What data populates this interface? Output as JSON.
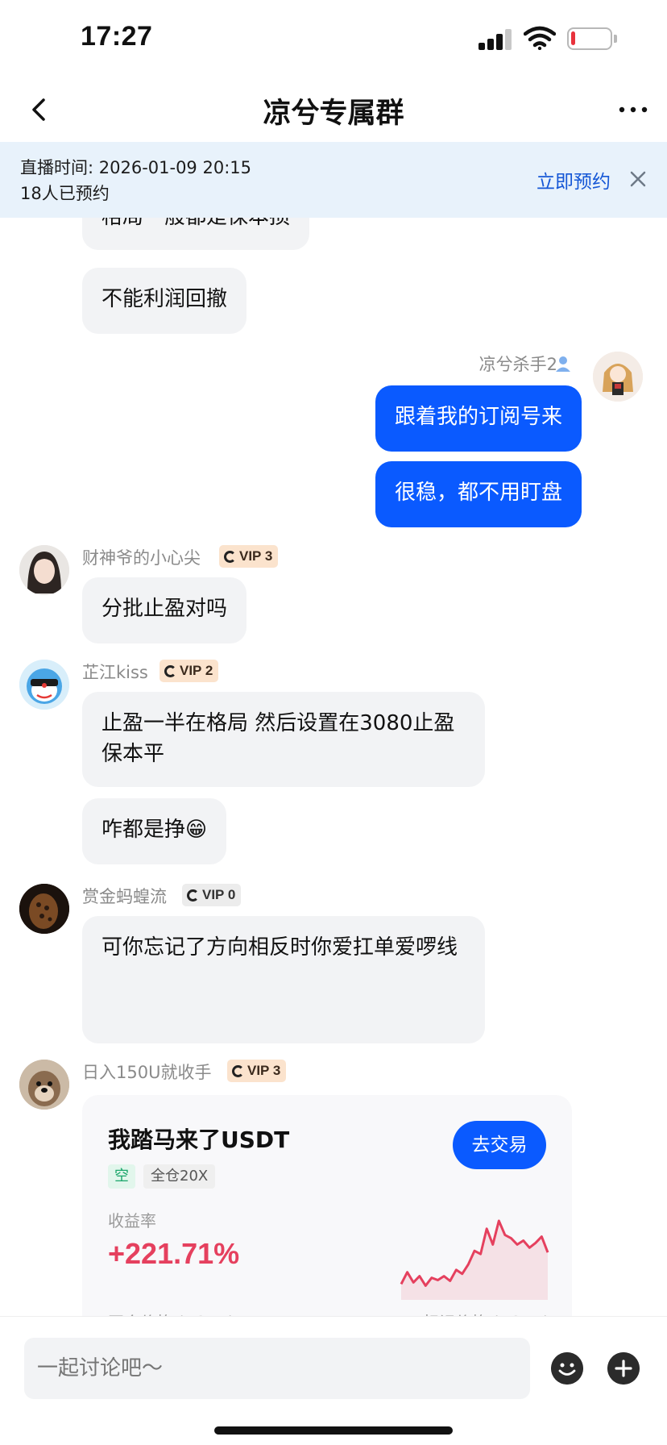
{
  "status_bar": {
    "time": "17:27",
    "battery_level": 0.1
  },
  "nav": {
    "title": "凉兮专属群"
  },
  "banner": {
    "line1": "直播时间: 2026-01-09 20:15",
    "line2": "18人已预约",
    "action_label": "立即预约"
  },
  "messages": {
    "m1": "格局一般都是保本损",
    "m2": "不能利润回撤",
    "self_name": "凉兮杀手2",
    "m3": "跟着我的订阅号来",
    "m4": "很稳，都不用盯盘",
    "u1_name": "财神爷的小心尖",
    "u1_vip": "VIP 3",
    "m5": "分批止盈对吗",
    "u2_name": "芷江kiss",
    "u2_vip": "VIP 2",
    "m6": "止盈一半在格局  然后设置在3080止盈保本平",
    "m7": "咋都是挣",
    "m7_emoji": "😁",
    "u3_name": "赏金蚂蝗流",
    "u3_vip": "VIP 0",
    "m8": "可你忘记了方向相反时你爱扛单爱啰线",
    "u4_name": "日入150U就收手",
    "u4_vip": "VIP 3"
  },
  "trade_card": {
    "title": "我踏马来了USDT",
    "button": "去交易",
    "side_tag": "空",
    "leverage_tag": "全仓20X",
    "pnl_label": "收益率",
    "pnl_value": "+221.71%",
    "col_left": "开仓价格 (USDT)",
    "col_right": "标记价格 (USDT)",
    "sparkline": [
      [
        0,
        0.2
      ],
      [
        1,
        0.35
      ],
      [
        2,
        0.22
      ],
      [
        3,
        0.3
      ],
      [
        4,
        0.18
      ],
      [
        5,
        0.28
      ],
      [
        6,
        0.25
      ],
      [
        7,
        0.3
      ],
      [
        8,
        0.24
      ],
      [
        9,
        0.38
      ],
      [
        10,
        0.33
      ],
      [
        11,
        0.45
      ],
      [
        12,
        0.62
      ],
      [
        13,
        0.58
      ],
      [
        14,
        0.9
      ],
      [
        15,
        0.7
      ],
      [
        16,
        1.0
      ],
      [
        17,
        0.82
      ],
      [
        18,
        0.78
      ],
      [
        19,
        0.7
      ],
      [
        20,
        0.75
      ],
      [
        21,
        0.66
      ],
      [
        22,
        0.72
      ],
      [
        23,
        0.8
      ],
      [
        24,
        0.6
      ]
    ]
  },
  "input": {
    "placeholder": "一起讨论吧～"
  },
  "colors": {
    "accent": "#0a5aff",
    "pnl": "#e5405e",
    "banner_bg": "#e8f2fb"
  }
}
